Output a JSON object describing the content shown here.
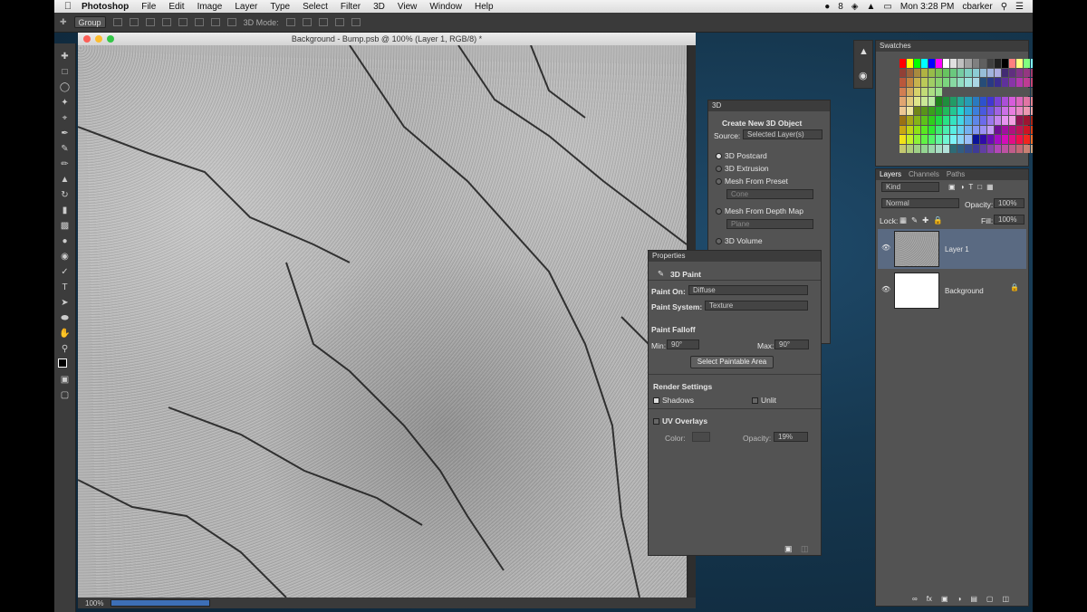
{
  "menubar": {
    "app": "Photoshop",
    "items": [
      "File",
      "Edit",
      "Image",
      "Layer",
      "Type",
      "Select",
      "Filter",
      "3D",
      "View",
      "Window",
      "Help"
    ],
    "time": "Mon 3:28 PM",
    "user": "cbarker",
    "badge": "8"
  },
  "options": {
    "group": "Group",
    "mode": "3D Mode:"
  },
  "document": {
    "title": "Background - Bump.psb @ 100% (Layer 1, RGB/8) *",
    "zoom": "100%"
  },
  "panel3d": {
    "title": "3D",
    "heading": "Create New 3D Object",
    "source_label": "Source:",
    "source_value": "Selected Layer(s)",
    "options": [
      "3D Postcard",
      "3D Extrusion",
      "Mesh From Preset",
      "Cone",
      "Mesh From Depth Map",
      "Plane",
      "3D Volume"
    ],
    "selected": "3D Postcard"
  },
  "properties": {
    "title": "Properties",
    "mode": "3D Paint",
    "paint_on_label": "Paint On:",
    "paint_on": "Diffuse",
    "paint_system_label": "Paint System:",
    "paint_system": "Texture",
    "falloff_heading": "Paint Falloff",
    "min_label": "Min:",
    "min": "90°",
    "max_label": "Max:",
    "max": "90°",
    "select_area": "Select Paintable Area",
    "render_heading": "Render Settings",
    "shadows": "Shadows",
    "shadows_checked": true,
    "unlit": "Unlit",
    "uv_heading": "UV Overlays",
    "color_label": "Color:",
    "opacity_label": "Opacity:",
    "opacity": "19%"
  },
  "swatches": {
    "title": "Swatches"
  },
  "layers": {
    "tabs": [
      "Layers",
      "Channels",
      "Paths"
    ],
    "filter": "Kind",
    "blend": "Normal",
    "opacity_label": "Opacity:",
    "opacity": "100%",
    "lock_label": "Lock:",
    "fill_label": "Fill:",
    "fill": "100%",
    "items": [
      {
        "name": "Layer 1",
        "selected": true
      },
      {
        "name": "Background",
        "locked": true
      }
    ]
  },
  "colors": {
    "accent": "#3d6fb6",
    "panel": "#535353",
    "selected_layer": "#5a6a82"
  }
}
